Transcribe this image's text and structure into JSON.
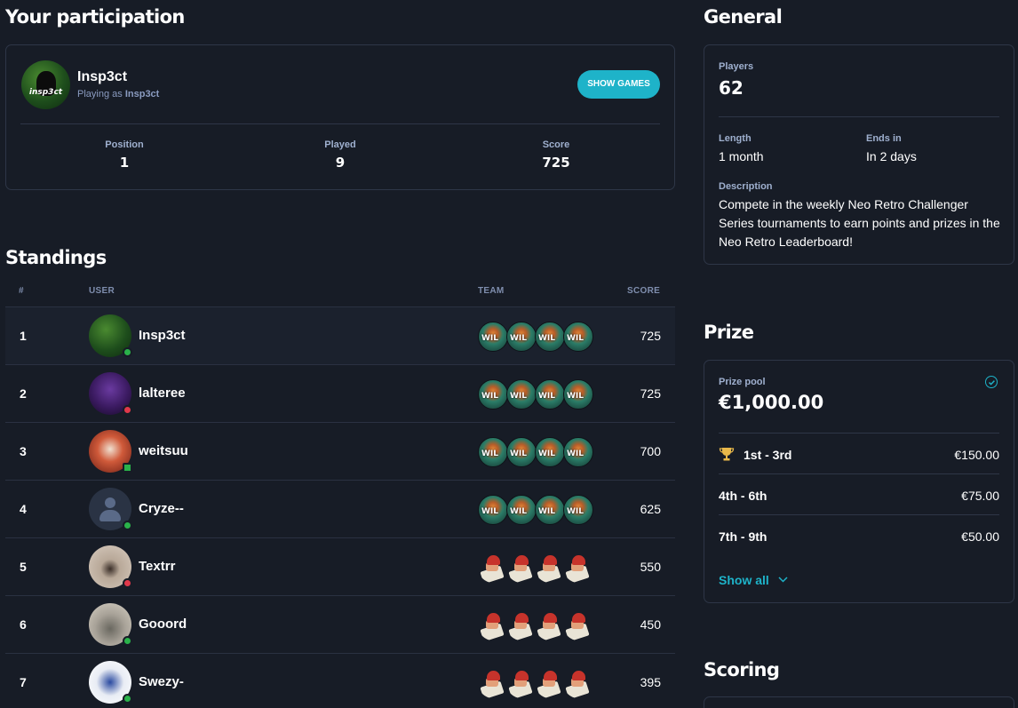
{
  "participation": {
    "title": "Your participation",
    "username": "Insp3ct",
    "playing_as_prefix": "Playing as",
    "playing_as_name": "Insp3ct",
    "avatar_text": "insp3ct",
    "show_games_label": "SHOW GAMES",
    "stats": [
      {
        "label": "Position",
        "value": "1"
      },
      {
        "label": "Played",
        "value": "9"
      },
      {
        "label": "Score",
        "value": "725"
      }
    ]
  },
  "standings": {
    "title": "Standings",
    "columns": {
      "rank": "#",
      "user": "USER",
      "team": "TEAM",
      "score": "SCORE"
    },
    "rows": [
      {
        "rank": "1",
        "user": "Insp3ct",
        "score": "725",
        "status": "online",
        "team_style": "a",
        "avatar_style": "green"
      },
      {
        "rank": "2",
        "user": "lalteree",
        "score": "725",
        "status": "busy",
        "team_style": "a",
        "avatar_style": "purple"
      },
      {
        "rank": "3",
        "user": "weitsuu",
        "score": "700",
        "status": "mobile",
        "team_style": "a",
        "avatar_style": "red"
      },
      {
        "rank": "4",
        "user": "Cryze--",
        "score": "625",
        "status": "online",
        "team_style": "a",
        "avatar_style": "default"
      },
      {
        "rank": "5",
        "user": "Textrr",
        "score": "550",
        "status": "busy",
        "team_style": "b",
        "avatar_style": "beige"
      },
      {
        "rank": "6",
        "user": "Gooord",
        "score": "450",
        "status": "online",
        "team_style": "b",
        "avatar_style": "grey"
      },
      {
        "rank": "7",
        "user": "Swezy-",
        "score": "395",
        "status": "online",
        "team_style": "b",
        "avatar_style": "white"
      }
    ]
  },
  "general": {
    "title": "General",
    "players_label": "Players",
    "players_value": "62",
    "length_label": "Length",
    "length_value": "1 month",
    "ends_label": "Ends in",
    "ends_value": "In 2 days",
    "description_label": "Description",
    "description_value": "Compete in the weekly Neo Retro Challenger Series tournaments to earn points and prizes in the Neo Retro Leaderboard!"
  },
  "prize": {
    "title": "Prize",
    "pool_label": "Prize pool",
    "pool_value": "€1,000.00",
    "rows": [
      {
        "place": "1st - 3rd",
        "amount": "€150.00",
        "icon": "trophy-icon"
      },
      {
        "place": "4th - 6th",
        "amount": "€75.00"
      },
      {
        "place": "7th - 9th",
        "amount": "€50.00"
      }
    ],
    "show_all_label": "Show all"
  },
  "scoring": {
    "title": "Scoring"
  },
  "colors": {
    "background": "#171c26",
    "accent": "#1eb3c9",
    "online": "#2ab24a",
    "busy": "#e0384a",
    "border": "#2e3647"
  }
}
